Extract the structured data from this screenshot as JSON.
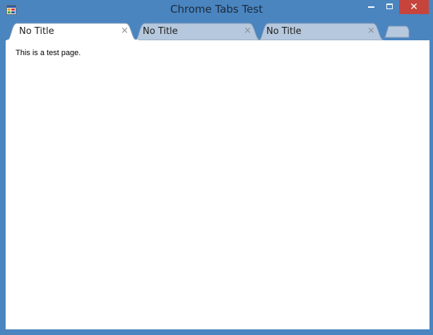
{
  "window": {
    "title": "Chrome Tabs Test",
    "app_icon": "windows-forms-app-icon",
    "controls": {
      "minimize_icon": "minimize-icon",
      "maximize_icon": "maximize-icon",
      "close_icon": "close-icon",
      "close_glyph": "✕"
    },
    "colors": {
      "frame": "#4a85c0",
      "close_button": "#c7443d",
      "active_tab": "#ffffff",
      "inactive_tab": "#b6c8dd"
    }
  },
  "tabs": [
    {
      "label": "No Title",
      "close_glyph": "×",
      "active": true
    },
    {
      "label": "No Title",
      "close_glyph": "×",
      "active": false
    },
    {
      "label": "No Title",
      "close_glyph": "×",
      "active": false
    }
  ],
  "new_tab": {
    "icon": "new-tab-icon"
  },
  "page": {
    "text": "This is a test page."
  }
}
